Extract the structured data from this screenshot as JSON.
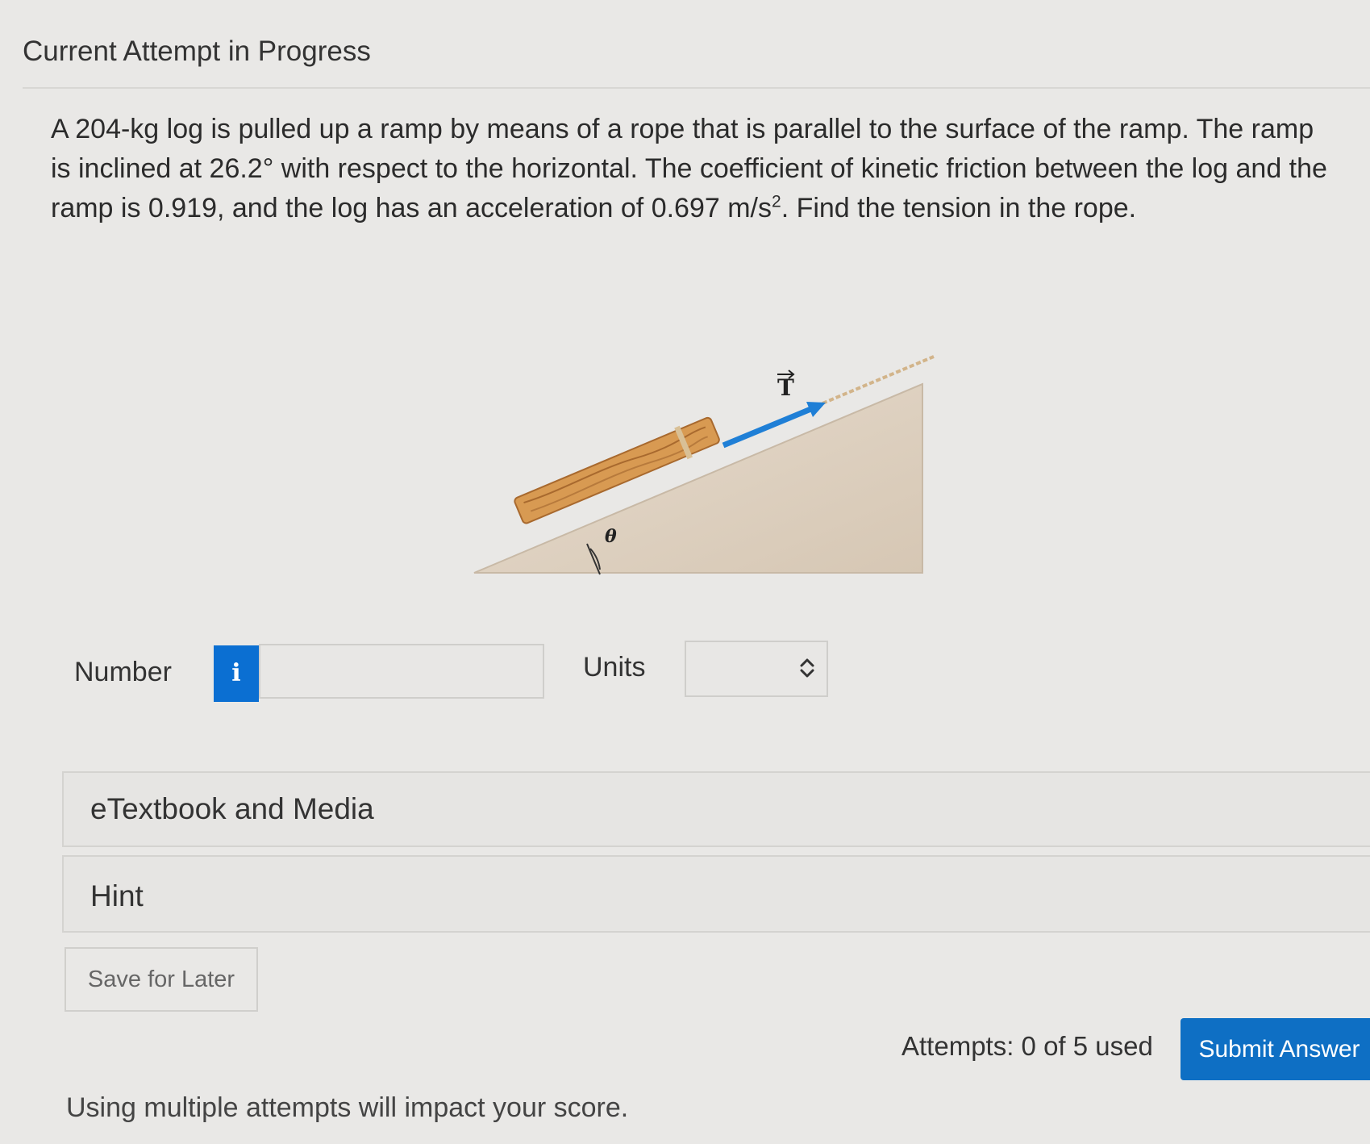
{
  "header": {
    "title": "Current Attempt in Progress"
  },
  "problem": {
    "text_before_sup": "A 204-kg log is pulled up a ramp by means of a rope that is parallel to the surface of the ramp. The ramp is inclined at 26.2° with respect to the horizontal. The coefficient of kinetic friction between the log and the ramp is 0.919, and the log has an acceleration of 0.697 m/s",
    "sup": "2",
    "text_after_sup": ". Find the tension in the rope."
  },
  "figure": {
    "tension_label": "T",
    "angle_label": "θ",
    "colors": {
      "ramp": "#ddd0c0",
      "ramp_edge": "#c8b9a6",
      "log": "#d89a52",
      "log_dark": "#a8692e",
      "arrow": "#1f7fd6"
    }
  },
  "answer": {
    "number_label": "Number",
    "info_icon": "info-icon",
    "info_glyph": "i",
    "number_value": "",
    "units_label": "Units",
    "units_selected": ""
  },
  "panels": {
    "etextbook_label": "eTextbook and Media",
    "hint_label": "Hint"
  },
  "actions": {
    "save_label": "Save for Later",
    "attempts_text": "Attempts: 0 of 5 used",
    "submit_label": "Submit Answer"
  },
  "footer": {
    "score_note": "Using multiple attempts will impact your score."
  }
}
